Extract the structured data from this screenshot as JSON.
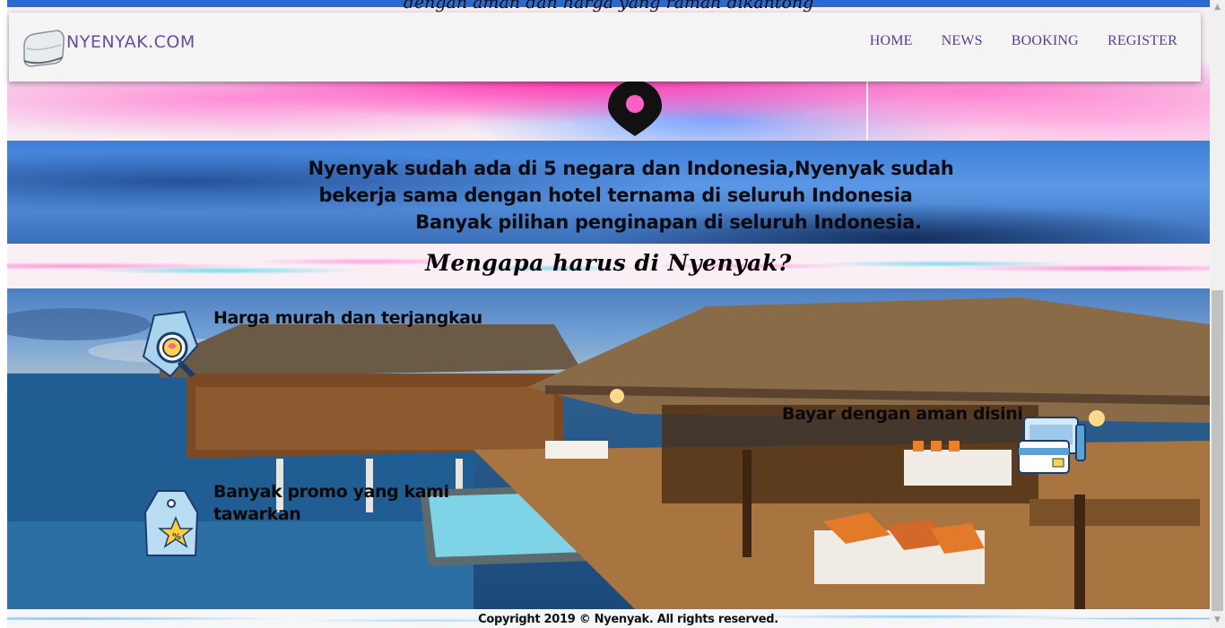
{
  "navbar": {
    "brand": "NYENYAK.COM",
    "links": [
      "HOME",
      "NEWS",
      "BOOKING",
      "REGISTER"
    ]
  },
  "hero": {
    "cut_text": "dengan aman dan harga yang ramah dikantong"
  },
  "info": {
    "line1": "Nyenyak sudah ada di 5 negara dan Indonesia,Nyenyak sudah",
    "line2": "bekerja sama dengan hotel ternama di seluruh Indonesia",
    "line3": "Banyak pilihan penginapan di seluruh Indonesia."
  },
  "why": {
    "title": "Mengapa harus di Nyenyak?"
  },
  "features": {
    "cheap": "Harga murah dan terjangkau",
    "promo_line1": "Banyak promo yang kami",
    "promo_line2": "tawarkan",
    "payment": "Bayar dengan aman disini"
  },
  "icons": {
    "cheap": "price-tag-magnifier-icon",
    "promo": "promo-tag-star-icon",
    "payment": "payment-cards-icon",
    "pin": "map-pin-icon"
  },
  "footer": {
    "copyright": "Copyright 2019 © Nyenyak. All rights reserved."
  },
  "colors": {
    "nav_text": "#5b3aa0",
    "brand_text": "#6a4c9c",
    "nav_bg": "#f4f4f4"
  }
}
